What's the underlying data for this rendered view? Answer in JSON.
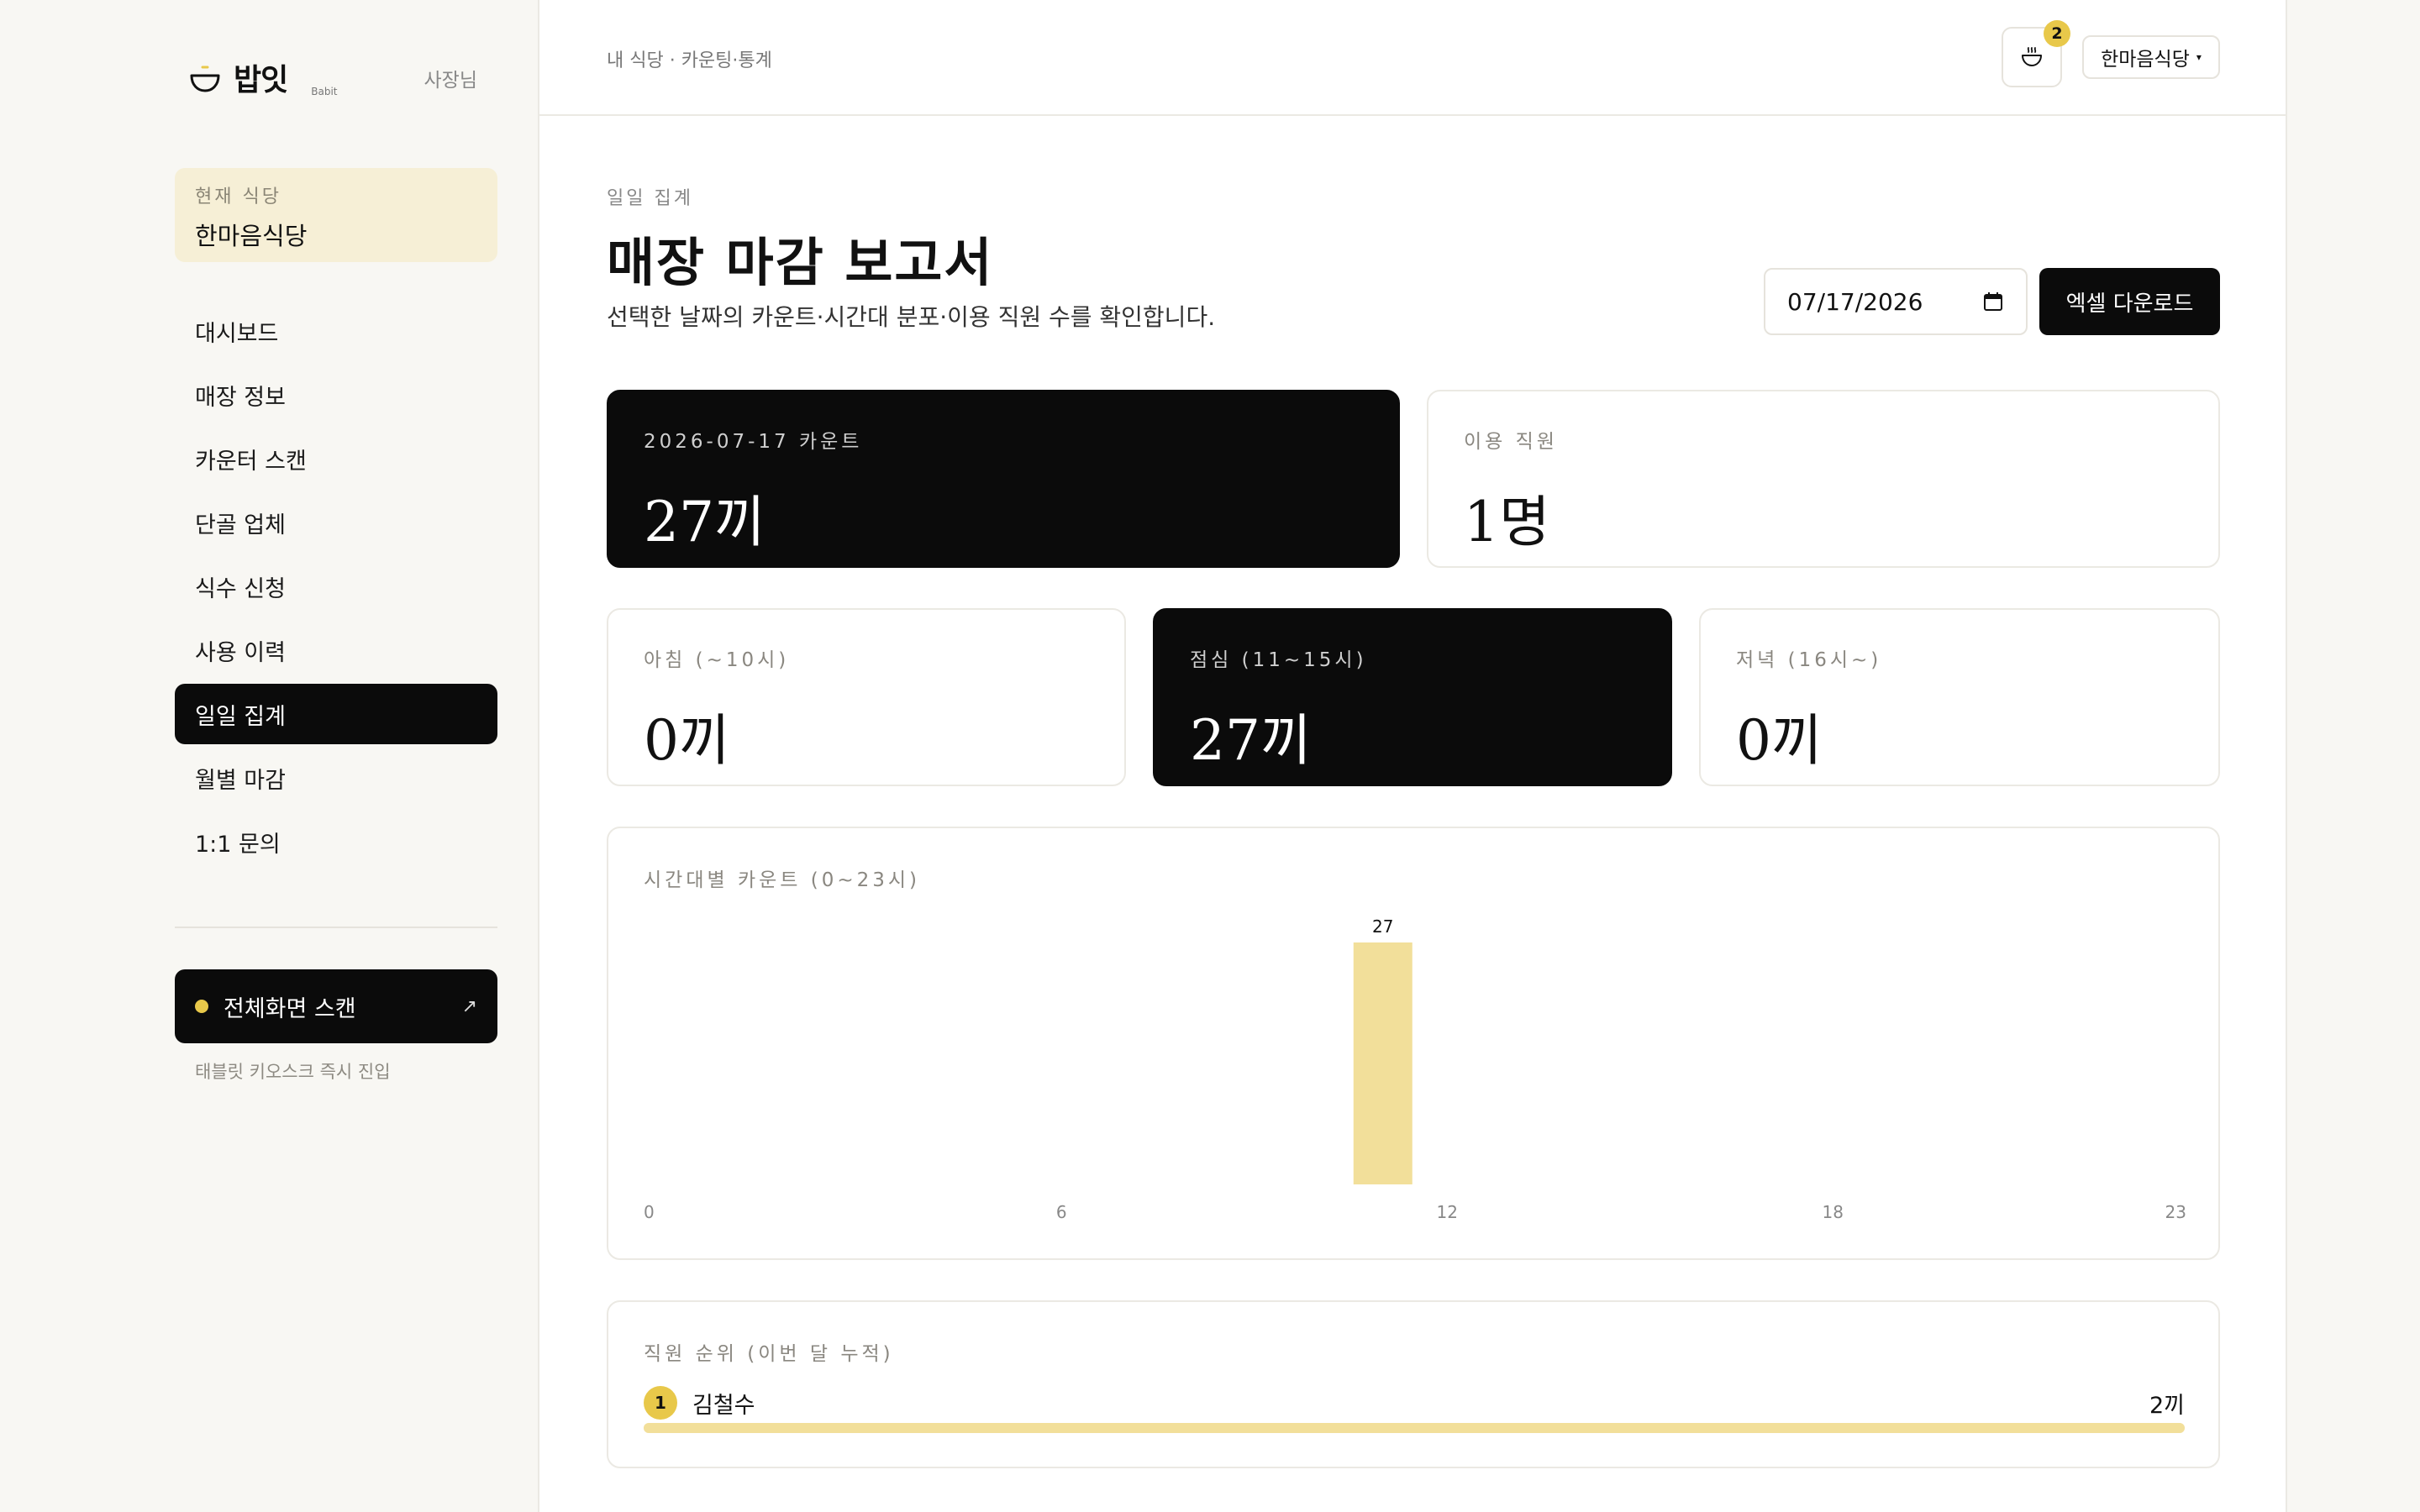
{
  "sidebar": {
    "brand_name": "밥잇",
    "brand_sub": "Babit",
    "owner_label": "사장님",
    "current_store_label": "현재 식당",
    "current_store_name": "한마음식당",
    "nav": [
      {
        "label": "대시보드",
        "active": false
      },
      {
        "label": "매장 정보",
        "active": false
      },
      {
        "label": "카운터 스캔",
        "active": false
      },
      {
        "label": "단골 업체",
        "active": false
      },
      {
        "label": "식수 신청",
        "active": false
      },
      {
        "label": "사용 이력",
        "active": false
      },
      {
        "label": "일일 집계",
        "active": true
      },
      {
        "label": "월별 마감",
        "active": false
      },
      {
        "label": "1:1 문의",
        "active": false
      }
    ],
    "scan_button_label": "전체화면 스캔",
    "scan_button_icon": "arrow-up-right-icon",
    "scan_sub": "태블릿 키오스크 즉시 진입"
  },
  "header": {
    "breadcrumb": "내 식당 · 카운팅·통계",
    "notification_count": "2",
    "store_select": "한마음식당"
  },
  "page": {
    "eyebrow": "일일 집계",
    "title": "매장 마감 보고서",
    "subtitle": "선택한 날짜의 카운트·시간대 분포·이용 직원 수를 확인합니다.",
    "date_value": "07/17/2026",
    "excel_button": "엑셀 다운로드"
  },
  "stats": {
    "total": {
      "label": "2026-07-17 카운트",
      "value": "27끼"
    },
    "staff": {
      "label": "이용 직원",
      "value": "1명"
    },
    "breakfast": {
      "label": "아침 (~10시)",
      "value": "0끼"
    },
    "lunch": {
      "label": "점심 (11~15시)",
      "value": "27끼"
    },
    "dinner": {
      "label": "저녁 (16시~)",
      "value": "0끼"
    }
  },
  "chart_data": {
    "type": "bar",
    "title": "시간대별 카운트 (0~23시)",
    "categories": [
      0,
      1,
      2,
      3,
      4,
      5,
      6,
      7,
      8,
      9,
      10,
      11,
      12,
      13,
      14,
      15,
      16,
      17,
      18,
      19,
      20,
      21,
      22,
      23
    ],
    "values": [
      0,
      0,
      0,
      0,
      0,
      0,
      0,
      0,
      0,
      0,
      0,
      27,
      0,
      0,
      0,
      0,
      0,
      0,
      0,
      0,
      0,
      0,
      0,
      0
    ],
    "tick_labels": [
      "0",
      "6",
      "12",
      "18",
      "23"
    ],
    "bar_color": "#f2df9a",
    "grid": false
  },
  "ranking": {
    "title": "직원 순위 (이번 달 누적)",
    "items": [
      {
        "rank": "1",
        "name": "김철수",
        "value": "2끼",
        "fraction": 1.0
      }
    ]
  },
  "colors": {
    "accent": "#e8c84a",
    "dark": "#0b0b0b",
    "bar": "#f2df9a"
  }
}
